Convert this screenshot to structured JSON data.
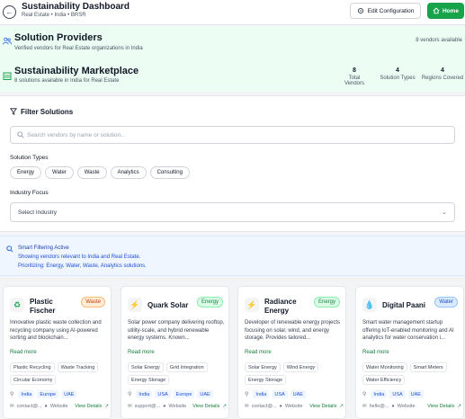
{
  "header": {
    "title": "Sustainability Dashboard",
    "subtitle": "Real Estate • India • BRSR",
    "back_icon": "arrow-left-icon",
    "edit_label": "Edit Configuration",
    "home_label": "Home"
  },
  "providers": {
    "title": "Solution Providers",
    "subtitle": "Verified vendors for Real Estate organizations in India",
    "count": "8 vendors available"
  },
  "marketplace": {
    "title": "Sustainability Marketplace",
    "subtitle": "8 solutions available in India for Real Estate",
    "stats": [
      {
        "value": "8",
        "label": "Total Vendors"
      },
      {
        "value": "4",
        "label": "Solution Types"
      },
      {
        "value": "4",
        "label": "Regions Covered"
      }
    ]
  },
  "filter": {
    "title": "Filter Solutions",
    "search_placeholder": "Search vendors by name or solution...",
    "solution_types_label": "Solution Types",
    "solution_types": [
      "Energy",
      "Water",
      "Waste",
      "Analytics",
      "Consulting"
    ],
    "industry_label": "Industry Focus",
    "industry_value": "Select Industry"
  },
  "smart": {
    "title": "Smart Filtering Active",
    "line1": "Showing vendors relevant to India and Real Estate.",
    "line2": "Prioritizing: Energy, Water, Waste, Analytics solutions."
  },
  "colors": {
    "accent": "#16a34a",
    "banner_bg": "#ecfdf3",
    "smart_bg": "#eff6ff"
  },
  "cards": [
    {
      "name": "Plastic Fischer",
      "icon": "recycle-icon",
      "tag": "Waste",
      "tag_bg": "#ffedd5",
      "tag_color": "#c2410c",
      "desc": "Innovative plastic waste collection and recycling company using AI-powered sorting and blockchain...",
      "read_more": "Read more",
      "features": [
        "Plastic Recycling",
        "Waste Tracking",
        "Circular Economy"
      ],
      "regions": [
        "India",
        "Europe",
        "UAE"
      ],
      "contact": "contact@...",
      "website": "Website",
      "details": "View Details"
    },
    {
      "name": "Quark Solar",
      "icon": "lightning-icon",
      "tag": "Energy",
      "tag_bg": "#dcfce7",
      "tag_color": "#15803d",
      "desc": "Solar power company delivering rooftop, utility-scale, and hybrid renewable energy systems. Known...",
      "read_more": "Read more",
      "features": [
        "Solar Energy",
        "Grid Integration",
        "Energy Storage"
      ],
      "regions": [
        "India",
        "USA",
        "Europe",
        "UAE"
      ],
      "contact": "support@...",
      "website": "Website",
      "details": "View Details"
    },
    {
      "name": "Radiance Energy",
      "icon": "lightning-icon",
      "tag": "Energy",
      "tag_bg": "#dcfce7",
      "tag_color": "#15803d",
      "desc": "Developer of renewable energy projects focusing on solar, wind, and energy storage. Provides tailored...",
      "read_more": "Read more",
      "features": [
        "Solar Energy",
        "Wind Energy",
        "Energy Storage"
      ],
      "regions": [
        "India",
        "USA",
        "UAE"
      ],
      "contact": "contact@...",
      "website": "Website",
      "details": "View Details"
    },
    {
      "name": "Digital Paani",
      "icon": "water-drop-icon",
      "tag": "Water",
      "tag_bg": "#dbeafe",
      "tag_color": "#1d4ed8",
      "desc": "Smart water management startup offering IoT-enabled monitoring and AI analytics for water conservation i...",
      "read_more": "Read more",
      "features": [
        "Water Monitoring",
        "Smart Meters",
        "Water Efficiency"
      ],
      "regions": [
        "India",
        "USA",
        "UAE"
      ],
      "contact": "hello@...",
      "website": "Website",
      "details": "View Details"
    }
  ]
}
